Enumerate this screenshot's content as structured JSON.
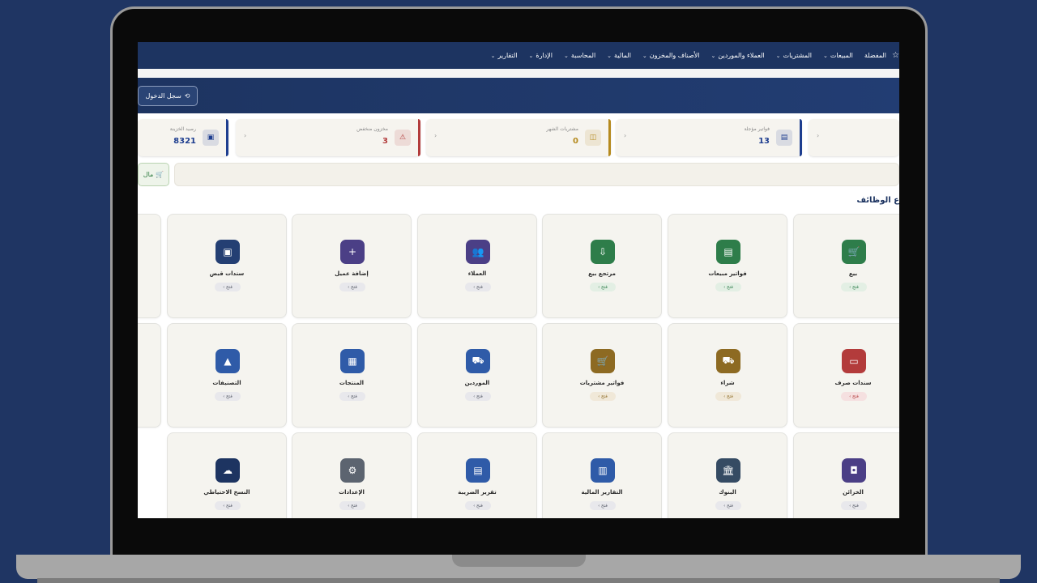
{
  "nav": {
    "star": "☆",
    "items": [
      {
        "label": "المفضلة",
        "chevron": false
      },
      {
        "label": "المبيعات",
        "chevron": true
      },
      {
        "label": "المشتريات",
        "chevron": true
      },
      {
        "label": "العملاء والموردين",
        "chevron": true
      },
      {
        "label": "الأصناف والمخزون",
        "chevron": true
      },
      {
        "label": "المالية",
        "chevron": true
      },
      {
        "label": "المحاسبة",
        "chevron": true
      },
      {
        "label": "الإدارة",
        "chevron": true
      },
      {
        "label": "التقارير",
        "chevron": true
      }
    ]
  },
  "hero": {
    "login_label": "سجل الدخول",
    "login_icon": "history-icon"
  },
  "stats": [
    {
      "label": "",
      "value": "",
      "color": "#1d3d8f",
      "icon": "",
      "arrow": "‹"
    },
    {
      "label": "فواتير مؤجلة",
      "value": "13",
      "color": "#1d3d8f",
      "icon": "invoice-icon",
      "arrow": "‹"
    },
    {
      "label": "مشتريات الشهر",
      "value": "0",
      "color": "#b58a1e",
      "icon": "bag-icon",
      "arrow": "‹"
    },
    {
      "label": "مخزون منخفض",
      "value": "3",
      "color": "#b23b3b",
      "icon": "warning-icon",
      "arrow": "‹"
    },
    {
      "label": "رصيد الخزينة",
      "value": "8321",
      "color": "#1d3d8f",
      "icon": "wallet-icon",
      "arrow": ""
    }
  ],
  "cart_button": "مال",
  "section_title": "ع الوظائف",
  "open_label": "فتح ›",
  "tiles": [
    {
      "label": "بيع",
      "icon": "cart-icon",
      "color": "#2e7d4a",
      "glyph": "🛒",
      "tone": "green"
    },
    {
      "label": "فواتير مبيعات",
      "icon": "receipt-icon",
      "color": "#2e7d4a",
      "glyph": "▤",
      "tone": "green"
    },
    {
      "label": "مرتجع بيع",
      "icon": "return-icon",
      "color": "#2e7d4a",
      "glyph": "⇩",
      "tone": "green"
    },
    {
      "label": "العملاء",
      "icon": "users-icon",
      "color": "#4b3f86",
      "glyph": "👥",
      "tone": "gray"
    },
    {
      "label": "إضافة عميل",
      "icon": "add-user-icon",
      "color": "#4b3f86",
      "glyph": "+",
      "tone": "gray"
    },
    {
      "label": "سندات قبض",
      "icon": "receipt-doc-icon",
      "color": "#243f73",
      "glyph": "▣",
      "tone": "gray"
    },
    {
      "label": "سندات صرف",
      "icon": "card-icon",
      "color": "#b33b3b",
      "glyph": "▭",
      "tone": "red"
    },
    {
      "label": "شراء",
      "icon": "truck-add-icon",
      "color": "#8d6a22",
      "glyph": "⛟",
      "tone": "brown"
    },
    {
      "label": "فواتير مشتريات",
      "icon": "shopping-cart-icon",
      "color": "#8d6a22",
      "glyph": "🛒",
      "tone": "brown"
    },
    {
      "label": "الموردين",
      "icon": "truck-icon",
      "color": "#2f5ba8",
      "glyph": "⛟",
      "tone": "gray"
    },
    {
      "label": "المنتجات",
      "icon": "box-icon",
      "color": "#2f5ba8",
      "glyph": "▦",
      "tone": "gray"
    },
    {
      "label": "التصنيفات",
      "icon": "shapes-icon",
      "color": "#2f5ba8",
      "glyph": "▲",
      "tone": "gray"
    },
    {
      "label": "الخزائن",
      "icon": "safe-icon",
      "color": "#4b3f86",
      "glyph": "◘",
      "tone": "gray"
    },
    {
      "label": "البنوك",
      "icon": "bank-icon",
      "color": "#354b63",
      "glyph": "🏛",
      "tone": "gray"
    },
    {
      "label": "التقارير المالية",
      "icon": "chart-icon",
      "color": "#2f5ba8",
      "glyph": "▥",
      "tone": "gray"
    },
    {
      "label": "تقرير الضريبة",
      "icon": "tax-report-icon",
      "color": "#2f5ba8",
      "glyph": "▤",
      "tone": "gray"
    },
    {
      "label": "الإعدادات",
      "icon": "gear-icon",
      "color": "#5c6470",
      "glyph": "⚙",
      "tone": "gray"
    },
    {
      "label": "النسخ الاحتياطي",
      "icon": "cloud-upload-icon",
      "color": "#1d3461",
      "glyph": "☁",
      "tone": "gray"
    }
  ]
}
